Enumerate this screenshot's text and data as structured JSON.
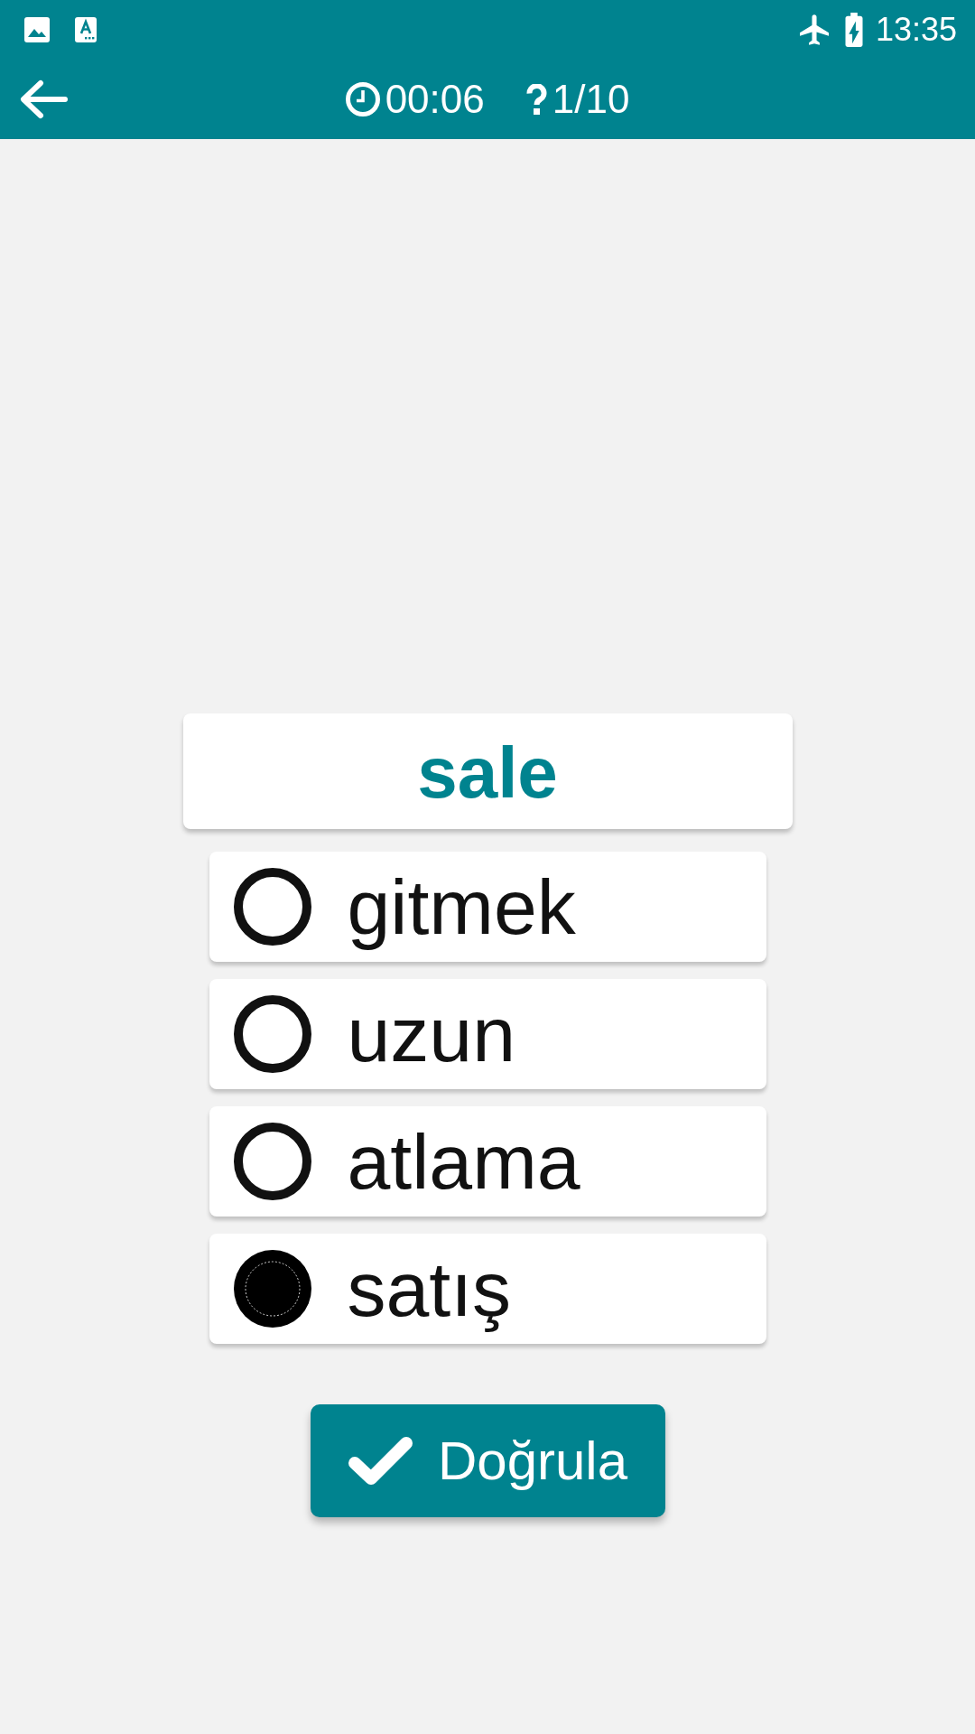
{
  "status_bar": {
    "time": "13:35"
  },
  "toolbar": {
    "timer": "00:06",
    "progress": "1/10"
  },
  "question": {
    "word": "sale"
  },
  "options": [
    {
      "label": "gitmek",
      "selected": false
    },
    {
      "label": "uzun",
      "selected": false
    },
    {
      "label": "atlama",
      "selected": false
    },
    {
      "label": "satış",
      "selected": true
    }
  ],
  "verify_button": {
    "label": "Doğrula"
  }
}
